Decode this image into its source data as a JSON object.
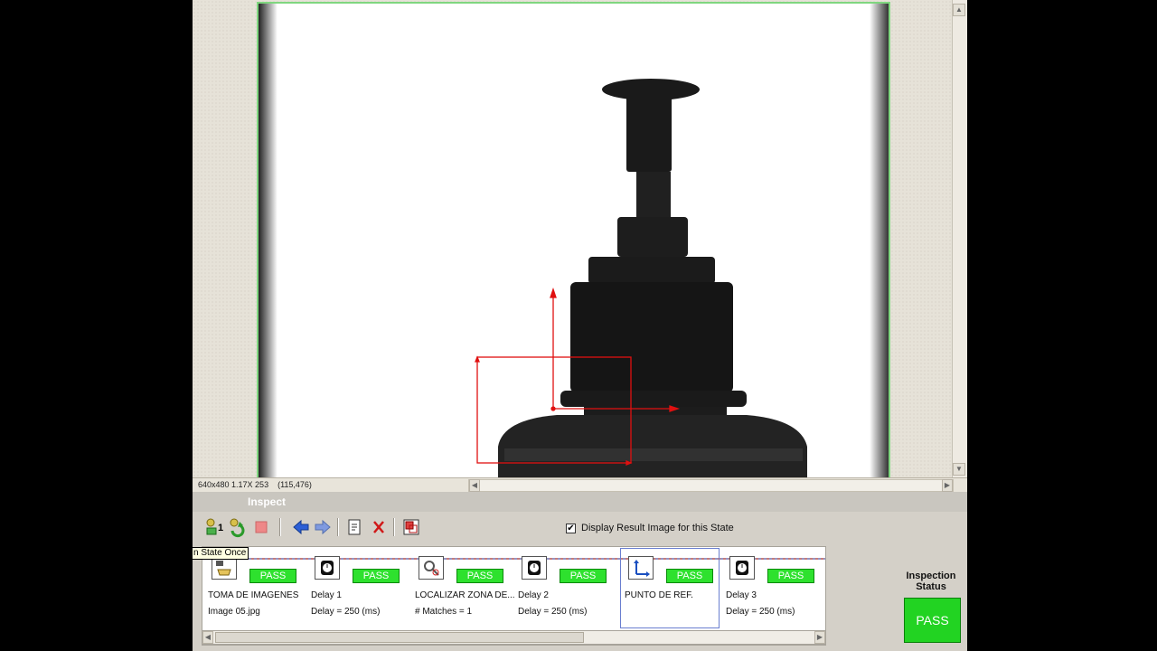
{
  "viewer": {
    "status_text": "640x480 1.17X 253    (115,476)"
  },
  "panel": {
    "title": "Inspect"
  },
  "toolbar": {
    "run_once_badge": "1",
    "tooltip": "n State Once",
    "display_result_checked": true,
    "display_result_label": "Display Result Image for this State"
  },
  "steps": [
    {
      "name": "TOMA DE IMAGENES",
      "detail": "Image 05.jpg",
      "status": "PASS",
      "icon": "acquire-image-icon"
    },
    {
      "name": "Delay 1",
      "detail": "Delay = 250 (ms)",
      "status": "PASS",
      "icon": "delay-timer-icon"
    },
    {
      "name": "LOCALIZAR ZONA DE...",
      "detail": "# Matches = 1",
      "status": "PASS",
      "icon": "pattern-match-icon"
    },
    {
      "name": "Delay 2",
      "detail": "Delay = 250 (ms)",
      "status": "PASS",
      "icon": "delay-timer-icon"
    },
    {
      "name": "PUNTO DE REF.",
      "detail": "",
      "status": "PASS",
      "icon": "coordinate-system-icon"
    },
    {
      "name": "Delay 3",
      "detail": "Delay = 250 (ms)",
      "status": "PASS",
      "icon": "delay-timer-icon"
    }
  ],
  "inspection": {
    "label_line1": "Inspection",
    "label_line2": "Status",
    "result": "PASS"
  },
  "colors": {
    "pass_green": "#2ee12e",
    "overlay_red": "#e01010",
    "frame_green": "#7fd67f"
  }
}
